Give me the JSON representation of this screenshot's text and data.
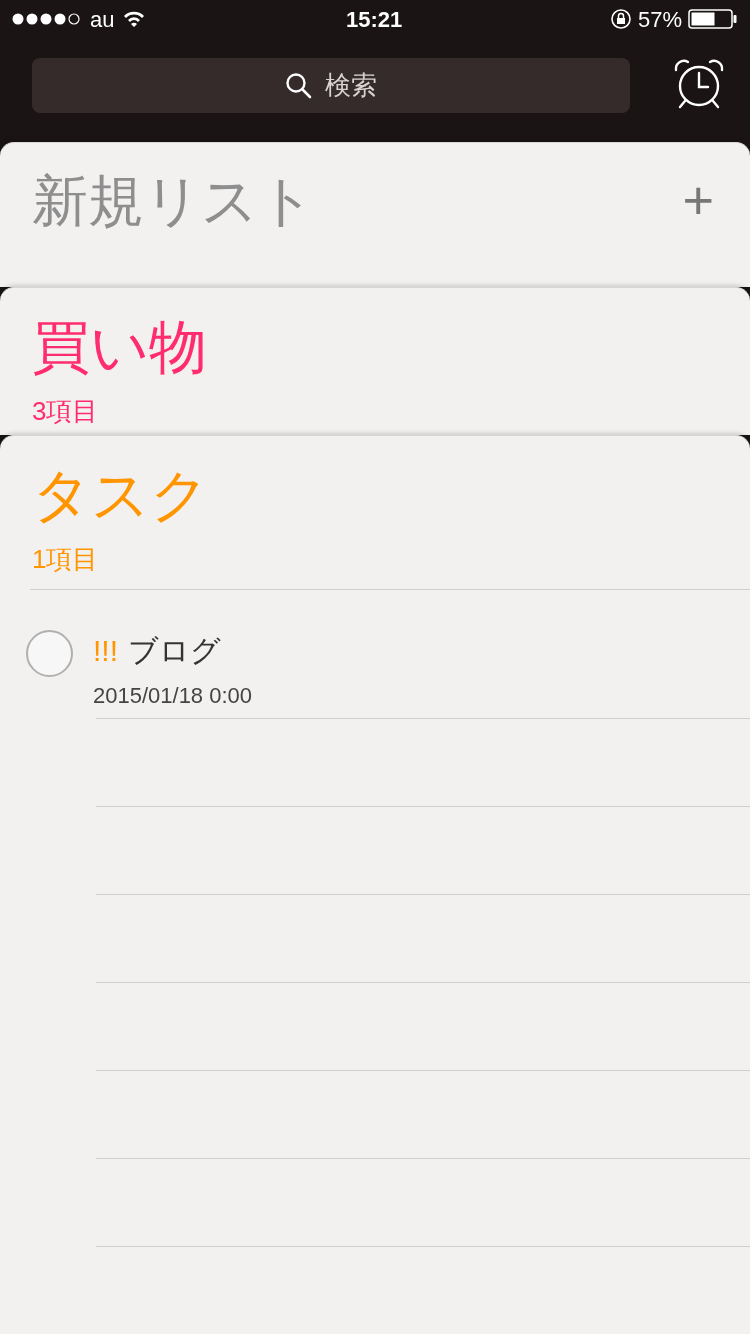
{
  "status_bar": {
    "carrier": "au",
    "time": "15:21",
    "battery": "57%"
  },
  "search": {
    "placeholder": "検索"
  },
  "new_list": {
    "title": "新規リスト",
    "add": "+"
  },
  "lists": [
    {
      "title": "買い物",
      "count": "3項目",
      "color": "#ff2d6f",
      "expanded": false
    },
    {
      "title": "タスク",
      "count": "1項目",
      "color": "#ff9500",
      "expanded": true,
      "items": [
        {
          "priority": "!!!",
          "title": "ブログ",
          "date": "2015/01/18 0:00",
          "checked": false
        }
      ]
    }
  ]
}
